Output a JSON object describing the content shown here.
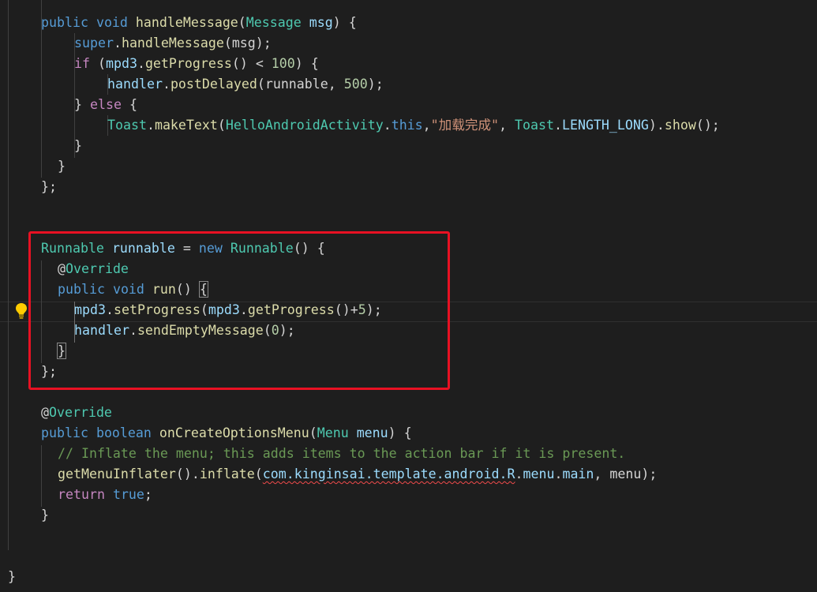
{
  "lines": [
    {
      "indent": 1,
      "tokens": [
        [
          "public",
          "k"
        ],
        [
          " ",
          "p"
        ],
        [
          "void",
          "k"
        ],
        [
          " ",
          "p"
        ],
        [
          "handleMessage",
          "f"
        ],
        [
          "(",
          "p"
        ],
        [
          "Message",
          "t"
        ],
        [
          " ",
          "p"
        ],
        [
          "msg",
          "v"
        ],
        [
          ") {",
          "p"
        ]
      ]
    },
    {
      "indent": 2,
      "tokens": [
        [
          "super",
          "k"
        ],
        [
          ".",
          "p"
        ],
        [
          "handleMessage",
          "f"
        ],
        [
          "(msg);",
          "p"
        ]
      ]
    },
    {
      "indent": 2,
      "tokens": [
        [
          "if",
          "c"
        ],
        [
          " (",
          "p"
        ],
        [
          "mpd3",
          "v"
        ],
        [
          ".",
          "p"
        ],
        [
          "getProgress",
          "f"
        ],
        [
          "() < ",
          "p"
        ],
        [
          "100",
          "n"
        ],
        [
          ") {",
          "p"
        ]
      ]
    },
    {
      "indent": 3,
      "tokens": [
        [
          "handler",
          "v"
        ],
        [
          ".",
          "p"
        ],
        [
          "postDelayed",
          "f"
        ],
        [
          "(runnable, ",
          "p"
        ],
        [
          "500",
          "n"
        ],
        [
          ");",
          "p"
        ]
      ]
    },
    {
      "indent": 2,
      "tokens": [
        [
          "} ",
          "p"
        ],
        [
          "else",
          "c"
        ],
        [
          " {",
          "p"
        ]
      ]
    },
    {
      "indent": 3,
      "tokens": [
        [
          "Toast",
          "t"
        ],
        [
          ".",
          "p"
        ],
        [
          "makeText",
          "f"
        ],
        [
          "(",
          "p"
        ],
        [
          "HelloAndroidActivity",
          "t"
        ],
        [
          ".",
          "p"
        ],
        [
          "this",
          "k"
        ],
        [
          ",",
          "p"
        ],
        [
          "\"加载完成\"",
          "s"
        ],
        [
          ", ",
          "p"
        ],
        [
          "Toast",
          "t"
        ],
        [
          ".",
          "p"
        ],
        [
          "LENGTH_LONG",
          "v"
        ],
        [
          ").",
          "p"
        ],
        [
          "show",
          "f"
        ],
        [
          "();",
          "p"
        ]
      ]
    },
    {
      "indent": 2,
      "tokens": [
        [
          "}",
          "p"
        ]
      ]
    },
    {
      "indent": 1.5,
      "tokens": [
        [
          "}",
          "p"
        ]
      ]
    },
    {
      "indent": 1,
      "tokens": [
        [
          "};",
          "p"
        ]
      ]
    },
    {
      "indent": 0,
      "tokens": []
    },
    {
      "indent": 0,
      "tokens": []
    },
    {
      "indent": 1,
      "tokens": [
        [
          "Runnable",
          "t"
        ],
        [
          " ",
          "p"
        ],
        [
          "runnable",
          "v"
        ],
        [
          " = ",
          "p"
        ],
        [
          "new",
          "k"
        ],
        [
          " ",
          "p"
        ],
        [
          "Runnable",
          "t"
        ],
        [
          "() {",
          "p"
        ]
      ]
    },
    {
      "indent": 1.5,
      "tokens": [
        [
          "@",
          "p"
        ],
        [
          "Override",
          "t"
        ]
      ]
    },
    {
      "indent": 1.5,
      "tokens": [
        [
          "public",
          "k"
        ],
        [
          " ",
          "p"
        ],
        [
          "void",
          "k"
        ],
        [
          " ",
          "p"
        ],
        [
          "run",
          "f"
        ],
        [
          "() ",
          "p"
        ],
        [
          "{",
          "bracket"
        ]
      ]
    },
    {
      "indent": 2,
      "tokens": [
        [
          "mpd3",
          "v"
        ],
        [
          ".",
          "p"
        ],
        [
          "setProgress",
          "f"
        ],
        [
          "(",
          "p"
        ],
        [
          "mpd3",
          "v"
        ],
        [
          ".",
          "p"
        ],
        [
          "getProgress",
          "f"
        ],
        [
          "()+",
          "p"
        ],
        [
          "5",
          "n"
        ],
        [
          ");",
          "p"
        ]
      ]
    },
    {
      "indent": 2,
      "tokens": [
        [
          "handler",
          "v"
        ],
        [
          ".",
          "p"
        ],
        [
          "sendEmptyMessage",
          "f"
        ],
        [
          "(",
          "p"
        ],
        [
          "0",
          "n"
        ],
        [
          ");",
          "p"
        ]
      ]
    },
    {
      "indent": 1.5,
      "tokens": [
        [
          "}",
          "bracket"
        ]
      ]
    },
    {
      "indent": 1,
      "tokens": [
        [
          "};",
          "p"
        ]
      ]
    },
    {
      "indent": 0,
      "tokens": []
    },
    {
      "indent": 1,
      "tokens": [
        [
          "@",
          "p"
        ],
        [
          "Override",
          "t"
        ]
      ]
    },
    {
      "indent": 1,
      "tokens": [
        [
          "public",
          "k"
        ],
        [
          " ",
          "p"
        ],
        [
          "boolean",
          "k"
        ],
        [
          " ",
          "p"
        ],
        [
          "onCreateOptionsMenu",
          "f"
        ],
        [
          "(",
          "p"
        ],
        [
          "Menu",
          "t"
        ],
        [
          " ",
          "p"
        ],
        [
          "menu",
          "v"
        ],
        [
          ") {",
          "p"
        ]
      ]
    },
    {
      "indent": 1.5,
      "tokens": [
        [
          "// Inflate the menu; this adds items to the action bar if it is present.",
          "cm"
        ]
      ]
    },
    {
      "indent": 1.5,
      "tokens": [
        [
          "getMenuInflater",
          "f"
        ],
        [
          "().",
          "p"
        ],
        [
          "inflate",
          "f"
        ],
        [
          "(",
          "p"
        ],
        [
          "com.kinginsai.template.android.R",
          "squiggle"
        ],
        [
          ".",
          "p"
        ],
        [
          "menu",
          "v"
        ],
        [
          ".",
          "p"
        ],
        [
          "main",
          "v"
        ],
        [
          ", menu);",
          "p"
        ]
      ]
    },
    {
      "indent": 1.5,
      "tokens": [
        [
          "return",
          "c"
        ],
        [
          " ",
          "p"
        ],
        [
          "true",
          "k"
        ],
        [
          ";",
          "p"
        ]
      ]
    },
    {
      "indent": 1,
      "tokens": [
        [
          "}",
          "p"
        ]
      ]
    },
    {
      "indent": 0,
      "tokens": []
    },
    {
      "indent": 0,
      "tokens": []
    },
    {
      "indent": 0,
      "tokens": [
        [
          "}",
          "p"
        ]
      ]
    }
  ],
  "highlight_color": "#e81123",
  "lightbulb_icon": "lightbulb-icon"
}
